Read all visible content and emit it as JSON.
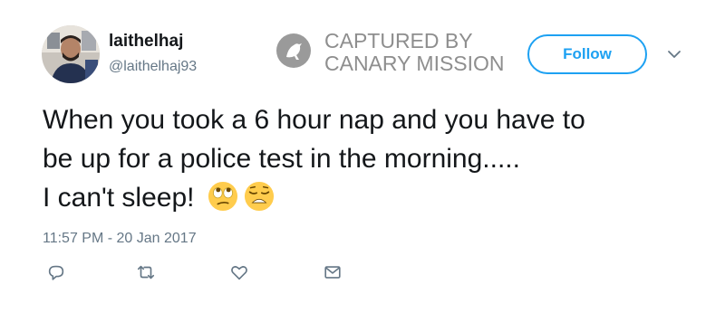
{
  "user": {
    "display_name": "laithelhaj",
    "handle": "@laithelhaj93"
  },
  "watermark": {
    "line1": "CAPTURED BY",
    "line2": "CANARY MISSION"
  },
  "follow_button": {
    "label": "Follow"
  },
  "tweet": {
    "lines": [
      "When you took a 6 hour nap and you have to",
      "be up for a police test in the morning.....",
      "I can't sleep!"
    ],
    "emojis": [
      "face-with-rolling-eyes-emoji",
      "weary-face-emoji"
    ],
    "timestamp": "11:57 PM - 20 Jan 2017"
  },
  "actions": [
    "reply-icon",
    "retweet-icon",
    "like-icon",
    "direct-message-icon"
  ],
  "colors": {
    "accent": "#1da1f2",
    "text": "#14171a",
    "secondary": "#657786",
    "watermark": "#8e8e8e"
  }
}
